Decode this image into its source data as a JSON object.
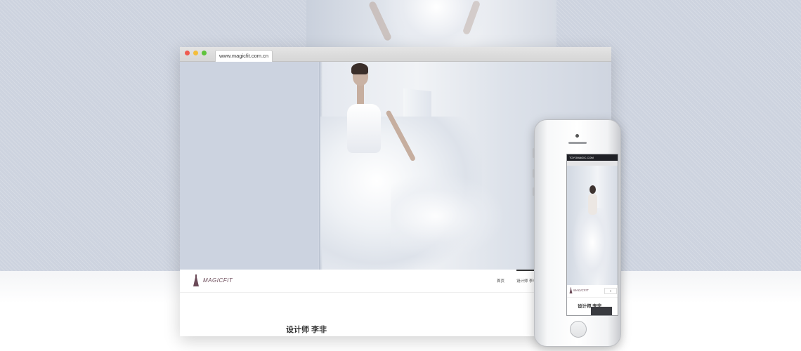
{
  "browser": {
    "url": "www.magicfit.com.cn"
  },
  "site": {
    "logo_text": "MAGICFIT",
    "nav": {
      "home": "首页",
      "designer": "设计师 李非"
    },
    "page_heading": "设计师 李非"
  },
  "phone": {
    "status_text": "TOYOMAGIC.COM",
    "logo_text": "MAGICFIT",
    "menu_label": "≡",
    "page_heading": "设计师 李非"
  },
  "colors": {
    "backdrop": "#cdd3df",
    "logo_accent": "#6b4a58",
    "traffic_red": "#ef5b4f",
    "traffic_yellow": "#f4be3a",
    "traffic_green": "#5fc33c"
  }
}
